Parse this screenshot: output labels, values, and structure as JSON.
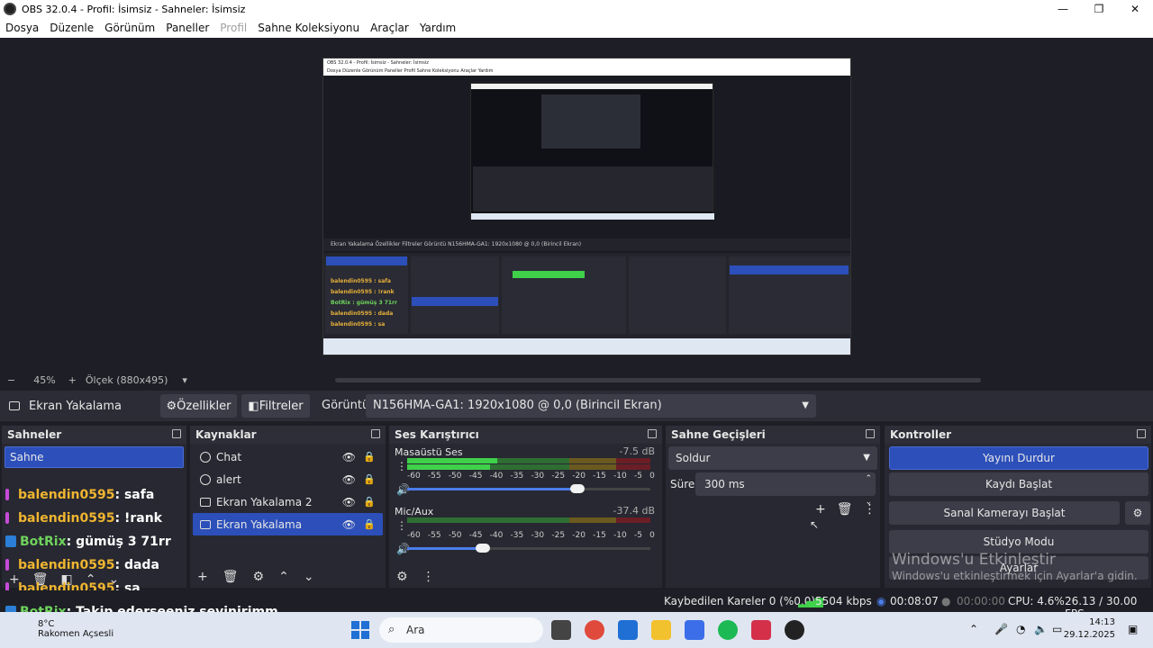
{
  "window": {
    "title": "OBS 32.0.4 - Profil: İsimsiz - Sahneler: İsimsiz"
  },
  "menu": [
    "Dosya",
    "Düzenle",
    "Görünüm",
    "Paneller",
    "Profil",
    "Sahne Koleksiyonu",
    "Araçlar",
    "Yardım"
  ],
  "zoom": {
    "minus": "−",
    "value": "45%",
    "plus": "+",
    "scale_label": "Ölçek (880x495)"
  },
  "source_toolbar": {
    "source_name": "Ekran Yakalama",
    "properties": "Özellikler",
    "filters": "Filtreler",
    "display_label": "Görüntü",
    "display_value": "N156HMA-GA1: 1920x1080 @ 0,0 (Birincil Ekran)"
  },
  "scenes": {
    "title": "Sahneler",
    "items": [
      "Sahne"
    ]
  },
  "sources": {
    "title": "Kaynaklar",
    "items": [
      {
        "name": "Chat",
        "icon": "globe-icon",
        "locked": false
      },
      {
        "name": "alert",
        "icon": "globe-icon",
        "locked": false
      },
      {
        "name": "Ekran Yakalama 2",
        "icon": "monitor-icon",
        "locked": true
      },
      {
        "name": "Ekran Yakalama",
        "icon": "monitor-icon",
        "locked": true,
        "selected": true
      }
    ]
  },
  "mixer": {
    "title": "Ses Karıştırıcı",
    "channels": [
      {
        "name": "Masaüstü Ses",
        "db": "-7.5 dB",
        "volume": 0.7
      },
      {
        "name": "Mic/Aux",
        "db": "-37.4 dB",
        "volume": 0.31
      }
    ],
    "ticks": [
      "-60",
      "-55",
      "-50",
      "-45",
      "-40",
      "-35",
      "-30",
      "-25",
      "-20",
      "-15",
      "-10",
      "-5",
      "0"
    ]
  },
  "transitions": {
    "title": "Sahne Geçişleri",
    "selected": "Soldur",
    "duration_label": "Süre",
    "duration_value": "300 ms"
  },
  "controls": {
    "title": "Kontroller",
    "stop_stream": "Yayını Durdur",
    "start_record": "Kaydı Başlat",
    "virtual_cam": "Sanal Kamerayı Başlat",
    "studio_mode": "Stüdyo Modu",
    "settings": "Ayarlar"
  },
  "status": {
    "dropped": "Kaybedilen Kareler 0 (%0.0)",
    "bitrate": "5504 kbps",
    "stream_time": "00:08:07",
    "rec_time": "00:00:00",
    "cpu": "CPU: 4.6%",
    "fps": "26.13 / 30.00 FPS"
  },
  "chat": [
    {
      "user": "balendin0595",
      "msg": ": safa",
      "bot": false
    },
    {
      "user": "balendin0595",
      "msg": ": !rank",
      "bot": false
    },
    {
      "user": "BotRix",
      "msg": ": gümüş 3 71rr",
      "bot": true
    },
    {
      "user": "balendin0595",
      "msg": ": dada",
      "bot": false
    },
    {
      "user": "balendin0595",
      "msg": ": sa",
      "bot": false
    },
    {
      "user": "BotRix",
      "msg": ": Takip ederseeniz sevinirimm",
      "bot": true
    }
  ],
  "watermark": {
    "line1": "Windows'u Etkinleştir",
    "line2": "Windows'u etkinleştirmek için Ayarlar'a gidin."
  },
  "taskbar": {
    "weather_temp": "8°C",
    "weather_desc": "Rakomen Açsesli",
    "search_placeholder": "Ara",
    "time": "14:13",
    "date": "29.12.2025"
  },
  "nested_preview": {
    "title": "OBS 32.0.4 - Profil: İsimsiz - Sahneler: İsimsiz",
    "source_label": "Ekran Yakalama",
    "display": "N156HMA-GA1: 1920x1080 @ 0,0 (Birincil Ekran)"
  },
  "colors": {
    "accent": "#2c4fba",
    "meter_green": "#3fd14a",
    "meter_yellow": "#c9a12a",
    "meter_red": "#c0303a",
    "chat_user": "#f0b530",
    "chat_bot": "#6ed35c"
  }
}
